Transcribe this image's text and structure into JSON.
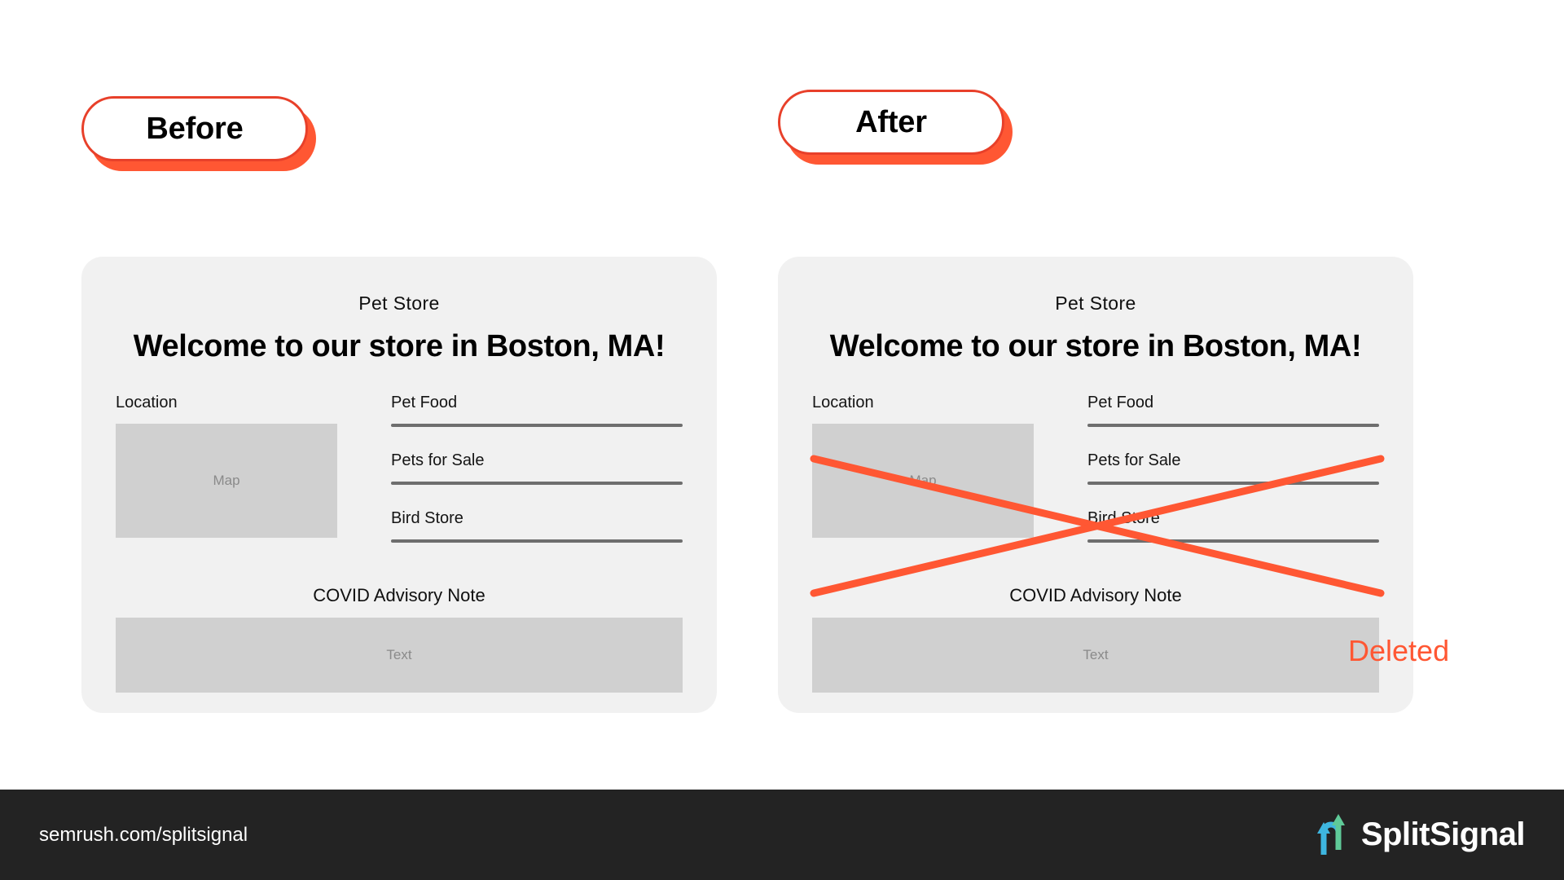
{
  "labels": {
    "before": "Before",
    "after": "After",
    "deleted": "Deleted"
  },
  "card_before": {
    "eyebrow": "Pet  Store",
    "title": "Welcome to our store in Boston, MA!",
    "location_label": "Location",
    "map_placeholder": "Map",
    "links": [
      {
        "text": "Pet Food"
      },
      {
        "text": "Pets for Sale"
      },
      {
        "text": "Bird Store"
      }
    ],
    "advisory_title": "COVID Advisory Note",
    "advisory_placeholder": "Text"
  },
  "card_after": {
    "eyebrow": "Pet  Store",
    "title": "Welcome to our store in Boston, MA!",
    "location_label": "Location",
    "map_placeholder": "Map",
    "links": [
      {
        "text": "Pet Food"
      },
      {
        "text": "Pets for Sale"
      },
      {
        "text": "Bird Store"
      }
    ],
    "advisory_title": "COVID Advisory Note",
    "advisory_placeholder": "Text"
  },
  "footer": {
    "url": "semrush.com/splitsignal",
    "brand_name": "SplitSignal"
  },
  "colors": {
    "accent_orange": "#ff5733",
    "border_orange": "#e8402a",
    "card_bg": "#f1f1f1",
    "placeholder_bg": "#d0d0d0",
    "rule_gray": "#6e6e6e",
    "footer_bg": "#232323",
    "logo_blue": "#3eb6e0",
    "logo_green": "#5fca98"
  }
}
